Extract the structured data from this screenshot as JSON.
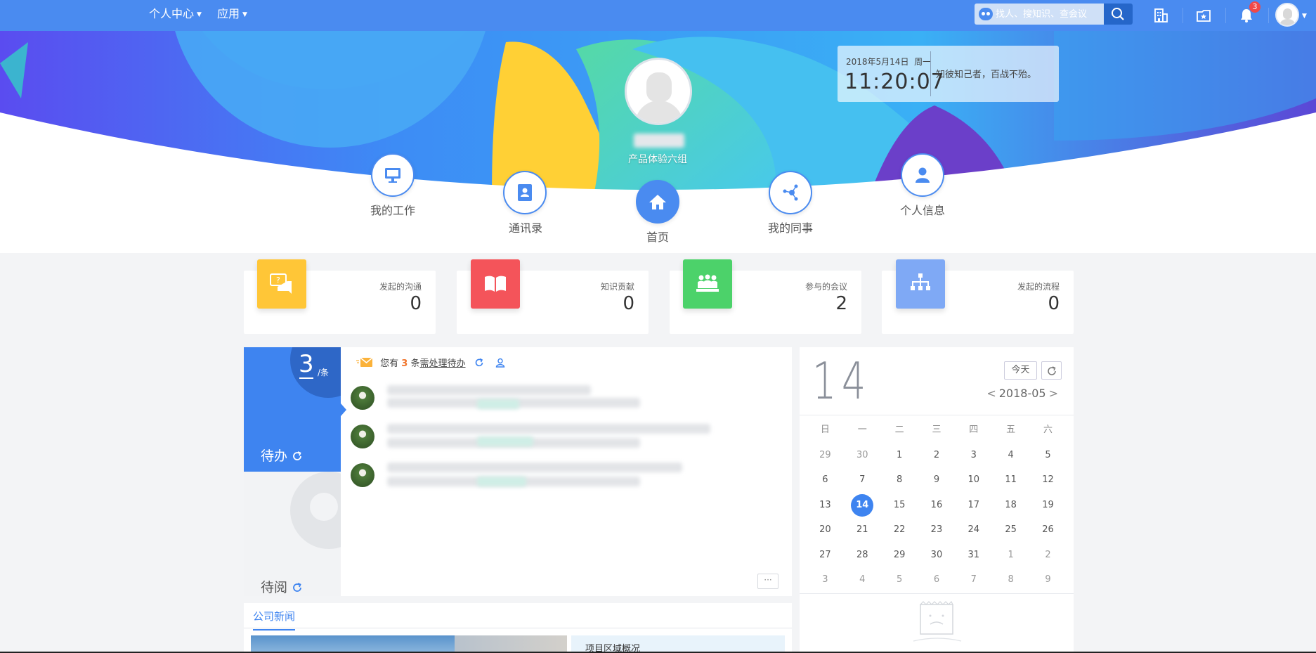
{
  "topbar": {
    "nav": [
      "个人中心",
      "应用"
    ],
    "search_placeholder": "找人、搜知识、查会议",
    "notification_count": "3",
    "icons": [
      "building-icon",
      "favorites-icon",
      "bell-icon",
      "search-icon"
    ]
  },
  "profile": {
    "group": "产品体验六组",
    "date": "2018年5月14日",
    "weekday": "周一",
    "time": "11:20:07",
    "quote": "知彼知己者，百战不殆。"
  },
  "quick_nav": [
    {
      "label": "我的工作",
      "icon": "monitor-icon"
    },
    {
      "label": "通讯录",
      "icon": "contacts-icon"
    },
    {
      "label": "首页",
      "icon": "home-icon"
    },
    {
      "label": "我的同事",
      "icon": "share-icon"
    },
    {
      "label": "个人信息",
      "icon": "user-icon"
    }
  ],
  "stats": [
    {
      "label": "发起的沟通",
      "value": "0",
      "color": "#ffc637"
    },
    {
      "label": "知识贡献",
      "value": "0",
      "color": "#f4545a"
    },
    {
      "label": "参与的会议",
      "value": "2",
      "color": "#4cd26a"
    },
    {
      "label": "发起的流程",
      "value": "0",
      "color": "#7fa9f5"
    }
  ],
  "todo": {
    "count": "3",
    "unit": "/条",
    "pending_label": "待办",
    "read_label": "待阅",
    "header_prefix": "您有",
    "header_count": "3",
    "header_mid": "条",
    "header_link": "需处理待办",
    "more": "···"
  },
  "calendar": {
    "day": "14",
    "today_label": "今天",
    "month": "2018-05",
    "prev": "<",
    "next": ">",
    "weekdays": [
      "日",
      "一",
      "二",
      "三",
      "四",
      "五",
      "六"
    ],
    "weeks": [
      [
        "29",
        "30",
        "1",
        "2",
        "3",
        "4",
        "5"
      ],
      [
        "6",
        "7",
        "8",
        "9",
        "10",
        "11",
        "12"
      ],
      [
        "13",
        "14",
        "15",
        "16",
        "17",
        "18",
        "19"
      ],
      [
        "20",
        "21",
        "22",
        "23",
        "24",
        "25",
        "26"
      ],
      [
        "27",
        "28",
        "29",
        "30",
        "31",
        "1",
        "2"
      ],
      [
        "3",
        "4",
        "5",
        "6",
        "7",
        "8",
        "9"
      ]
    ],
    "selected": "14"
  },
  "news": {
    "tab": "公司新闻",
    "first_title": "项目区域概况"
  },
  "colors": {
    "primary": "#4a8bf0",
    "accent_orange": "#f0742b"
  }
}
